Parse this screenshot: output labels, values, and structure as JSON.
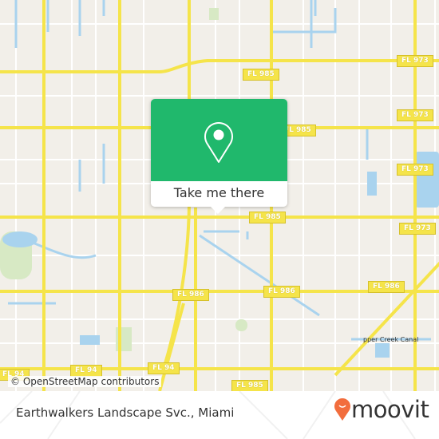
{
  "map": {
    "road_labels": [
      "FL 973",
      "FL 973",
      "FL 973",
      "FL 973",
      "FL 985",
      "FL 985",
      "FL 985",
      "FL 986",
      "FL 986",
      "FL 986",
      "FL 94",
      "FL 94",
      "FL 94",
      "FL 985"
    ],
    "canal_label": "pper Creek Canal",
    "attribution": "© OpenStreetMap contributors",
    "colors": {
      "land": "#f2efe9",
      "major_road": "#f5e44a",
      "water": "#a9d3ee",
      "park": "#d7e9c4"
    }
  },
  "popup": {
    "icon": "map-pin-icon",
    "action_label": "Take me there",
    "color": "#20b86c"
  },
  "footer": {
    "place_title": "Earthwalkers Landscape Svc., Miami",
    "brand": "moovit",
    "brand_color": "#f26d3d"
  }
}
